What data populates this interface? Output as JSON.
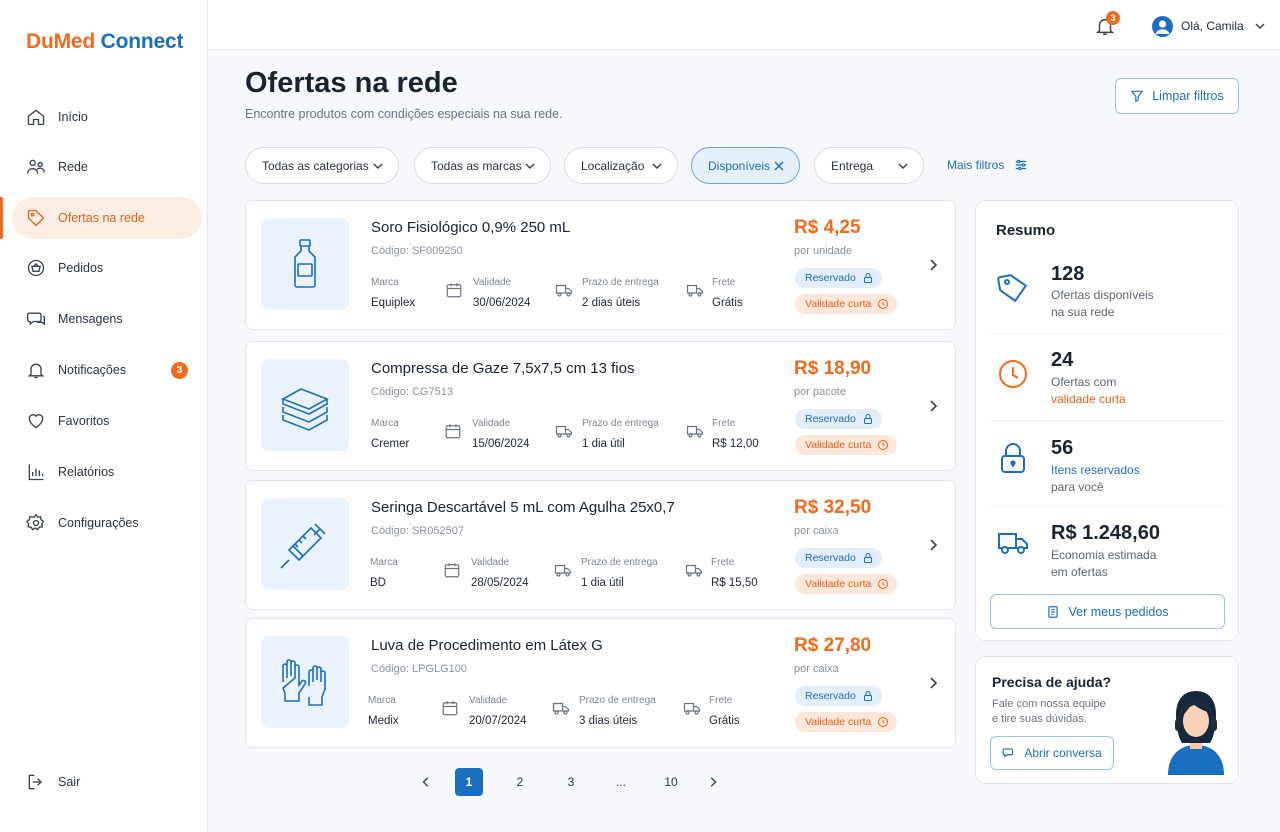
{
  "brand": {
    "part1": "DuMed",
    "part2": "Connect"
  },
  "nav": {
    "items": [
      {
        "label": "Início",
        "icon": "home-icon"
      },
      {
        "label": "Rede",
        "icon": "network-icon"
      },
      {
        "label": "Ofertas na rede",
        "icon": "tag-icon"
      },
      {
        "label": "Pedidos",
        "icon": "basket-icon"
      },
      {
        "label": "Mensagens",
        "icon": "chat-icon"
      },
      {
        "label": "Notificações",
        "icon": "bell-icon",
        "badge": "3"
      },
      {
        "label": "Favoritos",
        "icon": "heart-icon"
      },
      {
        "label": "Relatórios",
        "icon": "chart-icon"
      },
      {
        "label": "Configurações",
        "icon": "gear-icon"
      }
    ],
    "active": "Ofertas na rede",
    "logout": "Sair"
  },
  "topbar": {
    "notifications_count": "3",
    "greeting": "Olá, Camila"
  },
  "header": {
    "title": "Ofertas na rede",
    "subtitle": "Encontre produtos com condições especiais na sua rede.",
    "clear_filters": "Limpar filtros"
  },
  "filters": {
    "category": "Todas as categorias",
    "brand": "Todas as marcas",
    "location": "Localização",
    "availability": "Disponíveis",
    "delivery": "Entrega",
    "more": "Mais filtros"
  },
  "labels": {
    "brand": "Marca",
    "validity": "Validade",
    "delivery_time": "Prazo de entrega",
    "shipping": "Frete",
    "reserved": "Reservado",
    "short_validity": "Validade curta"
  },
  "products": [
    {
      "name": "Soro Fisiológico 0,9% 250 mL",
      "code": "Código: SF009250",
      "brand": "Equiplex",
      "validity": "30/06/2024",
      "delivery": "2 dias úteis",
      "shipping": "Grátis",
      "price": "R$ 4,25",
      "unit": "por unidade",
      "image": "bottle-icon"
    },
    {
      "name": "Compressa de Gaze 7,5x7,5 cm 13 fios",
      "code": "Código: CG7513",
      "brand": "Cremer",
      "validity": "15/06/2024",
      "delivery": "1 dia útil",
      "shipping": "R$ 12,00",
      "price": "R$ 18,90",
      "unit": "por pacote",
      "image": "gauze-icon"
    },
    {
      "name": "Seringa Descartável 5 mL com Agulha 25x0,7",
      "code": "Código: SR052507",
      "brand": "BD",
      "validity": "28/05/2024",
      "delivery": "1 dia útil",
      "shipping": "R$ 15,50",
      "price": "R$ 32,50",
      "unit": "por caixa",
      "image": "syringe-icon"
    },
    {
      "name": "Luva de Procedimento em Látex G",
      "code": "Código: LPGLG100",
      "brand": "Medix",
      "validity": "20/07/2024",
      "delivery": "3 dias úteis",
      "shipping": "Grátis",
      "price": "R$ 27,80",
      "unit": "por caixa",
      "image": "gloves-icon"
    }
  ],
  "pagination": {
    "pages": [
      "1",
      "2",
      "3",
      "...",
      "10"
    ],
    "current": "1"
  },
  "summary": {
    "title": "Resumo",
    "stats": [
      {
        "value": "128",
        "line1": "Ofertas disponíveis",
        "line2": "na sua rede",
        "icon": "tag-icon"
      },
      {
        "value": "24",
        "line1": "Ofertas com",
        "line2": "validade curta",
        "icon": "clock-icon"
      },
      {
        "value": "56",
        "line1": "Itens reservados",
        "line2": "para você",
        "icon": "lock-icon"
      },
      {
        "value": "R$ 1.248,60",
        "line1": "Economia estimada",
        "line2": "em ofertas",
        "icon": "truck-icon"
      }
    ],
    "orders_button": "Ver meus pedidos"
  },
  "help": {
    "title": "Precisa de ajuda?",
    "line1": "Fale com nossa equipe",
    "line2": "e tire suas dúvidas.",
    "button": "Abrir conversa"
  },
  "colors": {
    "primary": "#1a6fc1",
    "accent": "#f26a1b",
    "background": "#f6f8fb"
  }
}
